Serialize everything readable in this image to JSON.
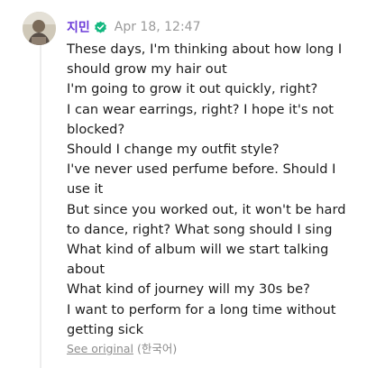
{
  "comment": {
    "author": "지민",
    "verified_icon": "verified-check-icon",
    "verified_color": "#14b880",
    "author_color": "#6b3bd8",
    "timestamp": "Apr 18, 12:47",
    "text_lines": [
      "These days, I'm thinking about how long I",
      "should grow my hair out",
      "I'm going to grow it out quickly, right?",
      "I can wear earrings, right? I hope it's not",
      "blocked?",
      "Should I change my outfit style?",
      "I've never used perfume before. Should I",
      "use it",
      "But since you worked out, it won't be hard",
      "to dance, right? What song should I sing",
      "What kind of album will we start talking",
      "about",
      "What kind of journey will my 30s be?",
      "I want to perform for a long time without",
      "getting sick"
    ],
    "see_original_label": "See original",
    "original_language": "(한국어)"
  }
}
